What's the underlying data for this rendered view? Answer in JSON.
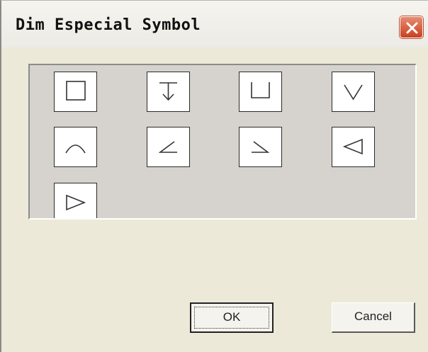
{
  "window": {
    "title": "Dim Especial Symbol",
    "close_icon": "close-icon"
  },
  "symbols": [
    {
      "name": "square-symbol",
      "icon": "square-icon"
    },
    {
      "name": "depth-symbol",
      "icon": "depth-down-arrow-icon"
    },
    {
      "name": "counterbore-symbol",
      "icon": "counterbore-icon"
    },
    {
      "name": "countersink-symbol",
      "icon": "countersink-v-icon"
    },
    {
      "name": "arc-length-symbol",
      "icon": "arc-icon"
    },
    {
      "name": "angle-left-symbol",
      "icon": "angle-left-icon"
    },
    {
      "name": "angle-right-symbol",
      "icon": "angle-right-icon"
    },
    {
      "name": "taper-left-symbol",
      "icon": "triangle-left-icon"
    },
    {
      "name": "taper-right-symbol",
      "icon": "triangle-right-icon"
    }
  ],
  "buttons": {
    "ok_label": "OK",
    "cancel_label": "Cancel"
  },
  "colors": {
    "close_button": "#c9401f",
    "panel_background": "#d6d3ce",
    "dialog_background": "#ece9d8"
  }
}
